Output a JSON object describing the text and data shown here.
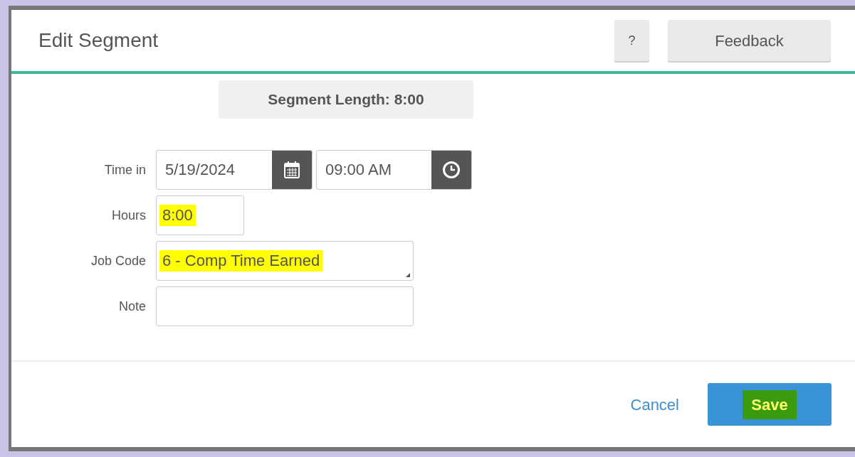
{
  "dialog": {
    "title": "Edit Segment",
    "help_button": "?",
    "feedback_button": "Feedback"
  },
  "segment_length": "Segment Length: 8:00",
  "fields": [
    {
      "kind": "datetime",
      "label": "Time in",
      "date": "5/19/2024",
      "time": "09:00 AM"
    },
    {
      "kind": "text",
      "label": "Hours",
      "value": "8:00",
      "highlighted": true
    },
    {
      "kind": "select",
      "label": "Job Code",
      "value": "6 - Comp Time Earned",
      "highlighted": true
    },
    {
      "kind": "text",
      "label": "Note"
    }
  ],
  "footer": {
    "cancel": "Cancel",
    "save": {
      "label": "Save",
      "highlighted": true
    }
  }
}
